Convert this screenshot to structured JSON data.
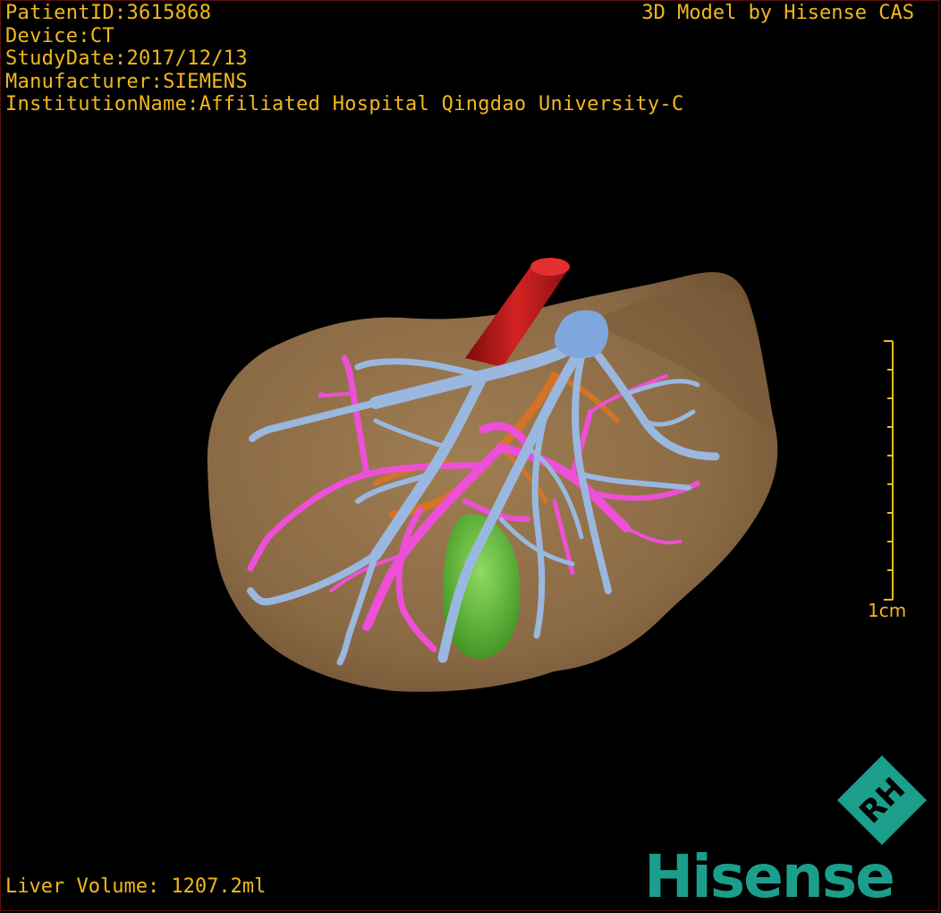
{
  "overlay": {
    "patient_id": "PatientID:3615868",
    "device": "Device:CT",
    "study_date": "StudyDate:2017/12/13",
    "manufacturer": "Manufacturer:SIEMENS",
    "institution": "InstitutionName:Affiliated Hospital Qingdao University-C",
    "credit": "3D Model by Hisense CAS",
    "liver_volume": "Liver Volume: 1207.2ml",
    "scale_label": "1cm"
  },
  "brand": {
    "name": "Hisense",
    "mark_text": "RH",
    "color": "#1c9e8c"
  },
  "colors": {
    "overlay_text": "#f2b81c",
    "liver": "#8a6a45",
    "portal_vein": "#9ab8df",
    "hepatic_vein": "#ee4fd8",
    "artery": "#b51616",
    "gallbladder": "#5fc23a",
    "duct": "#e0731f"
  },
  "icons": {
    "scale_bar": "vertical-ruler-icon",
    "brand_mark": "rh-diamond-logo-icon"
  }
}
